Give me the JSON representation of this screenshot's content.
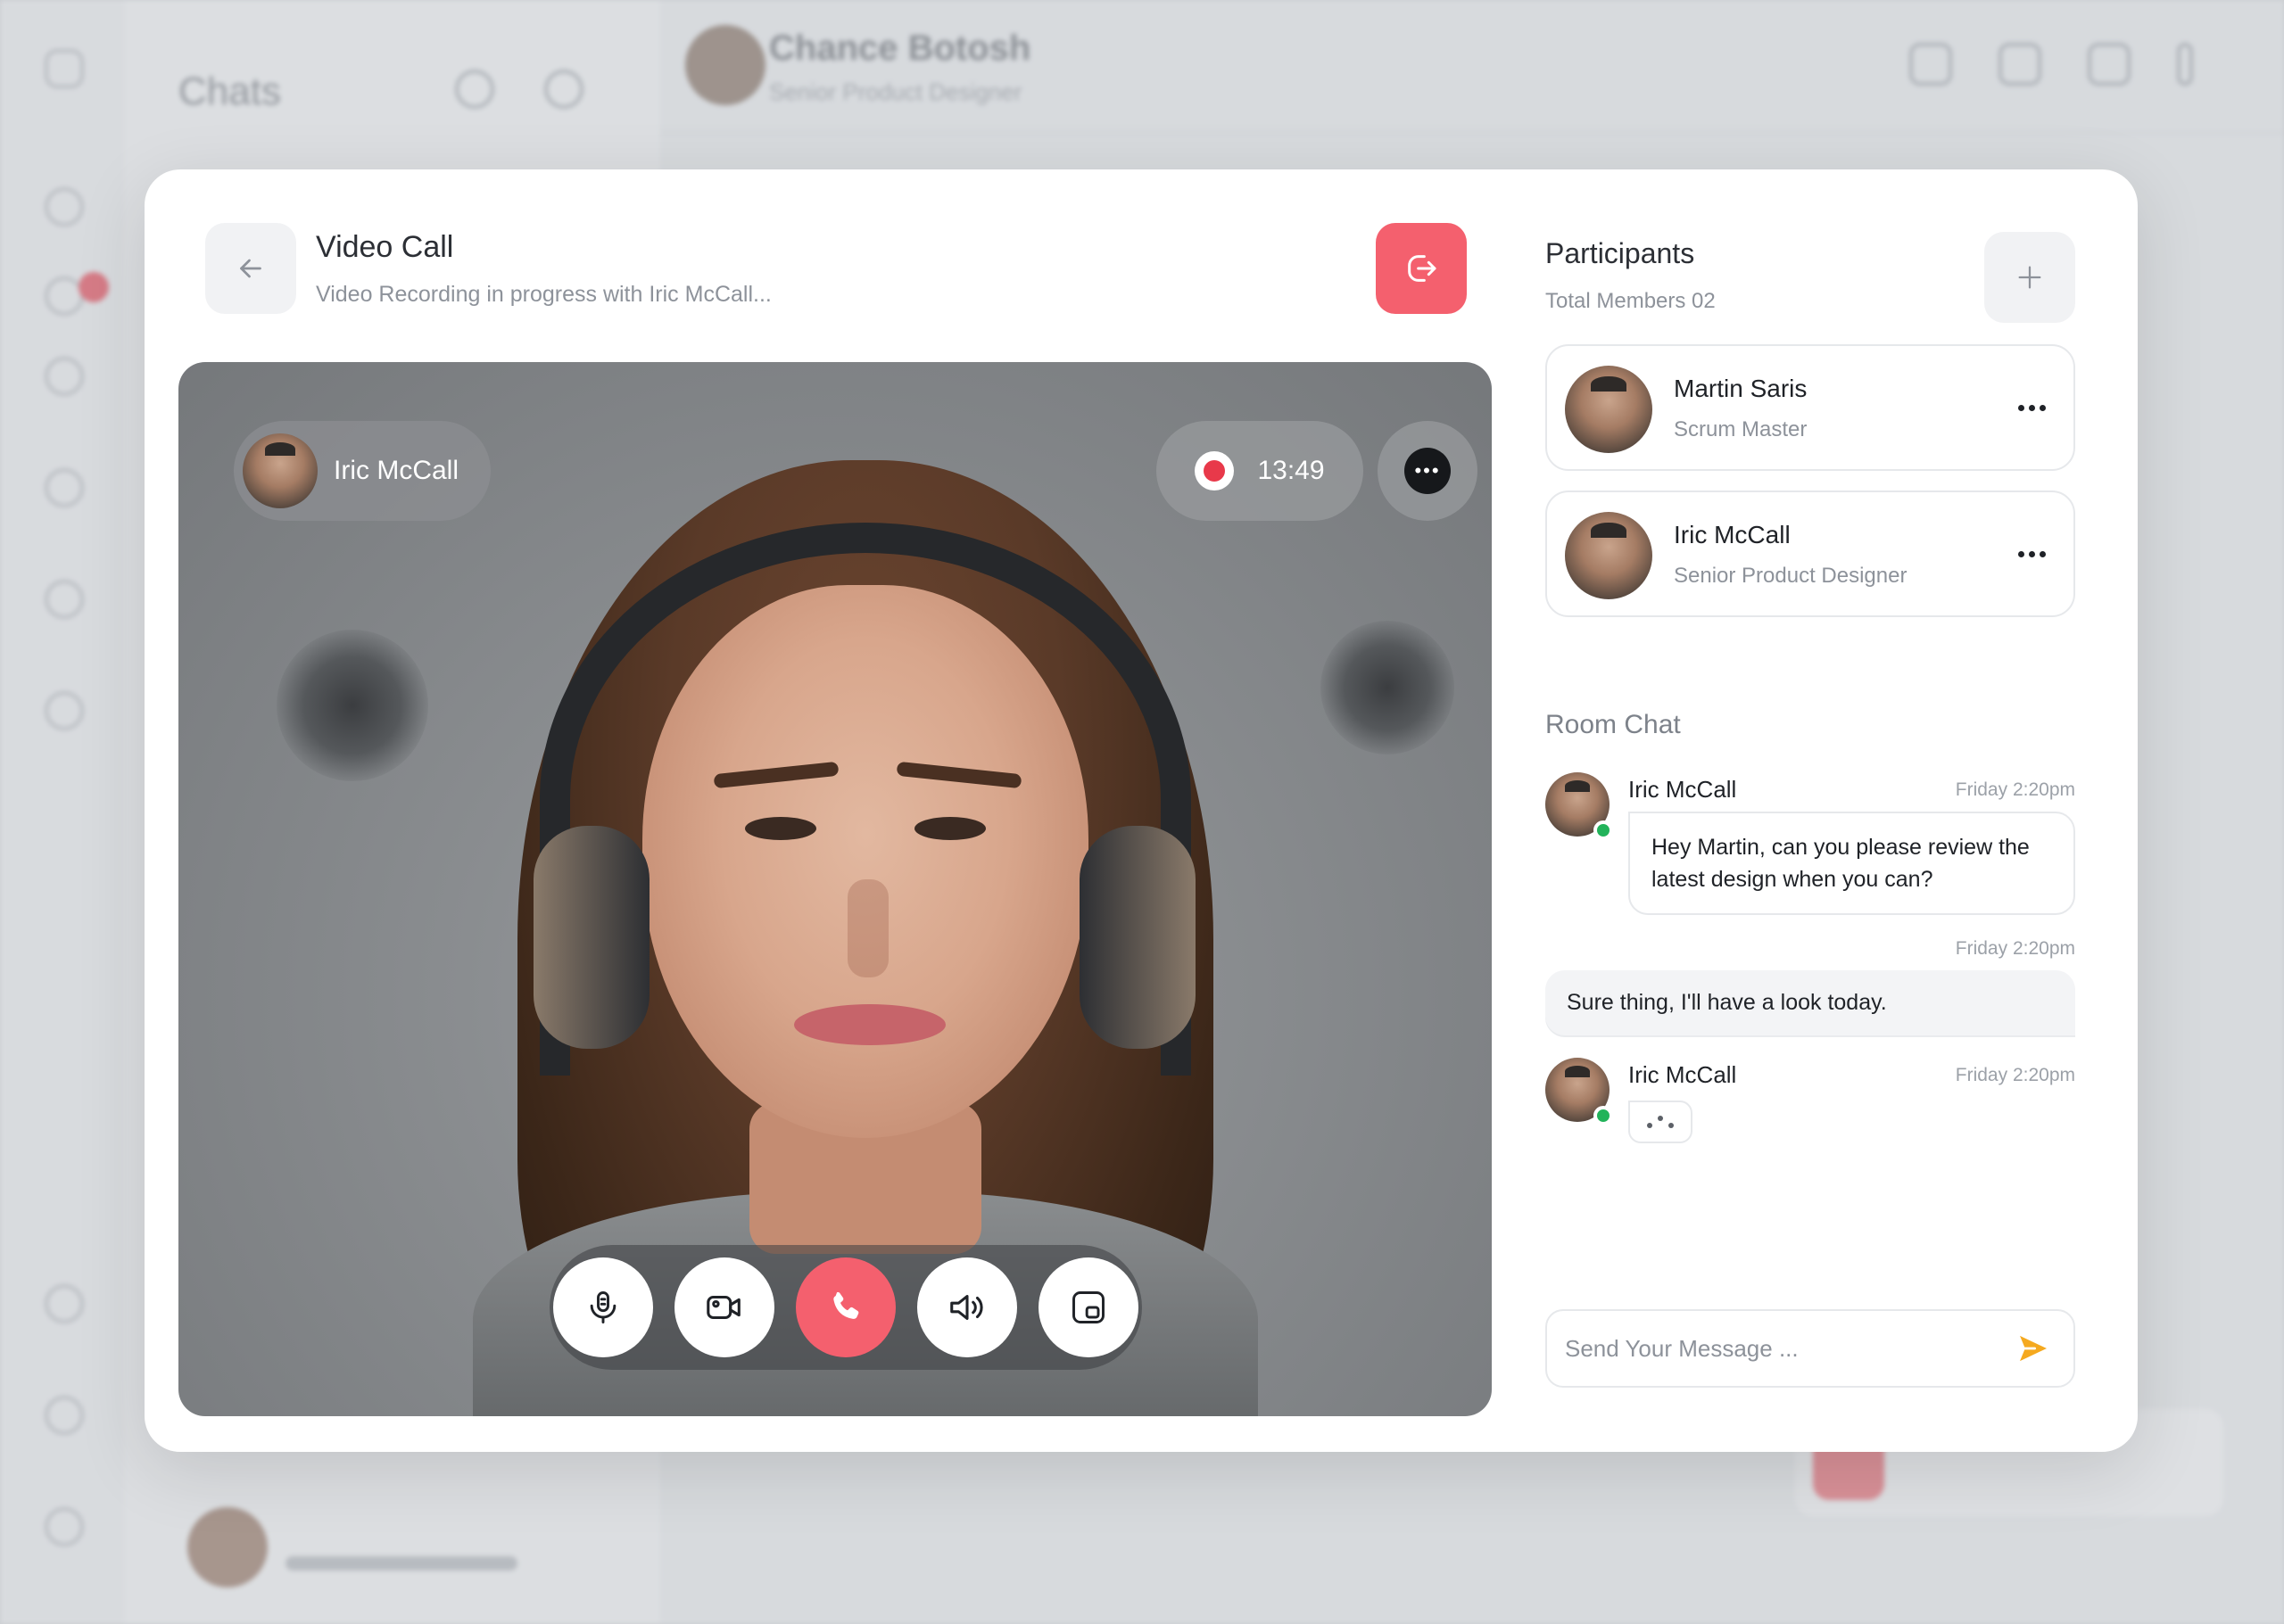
{
  "background": {
    "chats_title": "Chats",
    "contact_name": "Chance Botosh",
    "contact_role": "Senior Product Designer"
  },
  "call": {
    "title": "Video Call",
    "subtitle": "Video Recording in progress with Iric McCall...",
    "caller_name": "Iric McCall",
    "timer": "13:49"
  },
  "participants": {
    "title": "Participants",
    "total": "Total Members 02",
    "list": [
      {
        "name": "Martin Saris",
        "role": "Scrum Master"
      },
      {
        "name": "Iric McCall",
        "role": "Senior Product Designer"
      }
    ]
  },
  "room_chat": {
    "title": "Room Chat",
    "messages": [
      {
        "sender": "Iric McCall",
        "time": "Friday 2:20pm",
        "text": "Hey Martin, can you please review the latest design when you can?"
      },
      {
        "sender": "",
        "time": "Friday 2:20pm",
        "text": "Sure thing, I'll have a look today."
      },
      {
        "sender": "Iric McCall",
        "time": "Friday 2:20pm",
        "text": ""
      }
    ]
  },
  "composer": {
    "placeholder": "Send Your Message ..."
  },
  "colors": {
    "accent_red": "#f4606e",
    "recording": "#e8394a",
    "online": "#22b35a",
    "send": "#f5a91f"
  }
}
